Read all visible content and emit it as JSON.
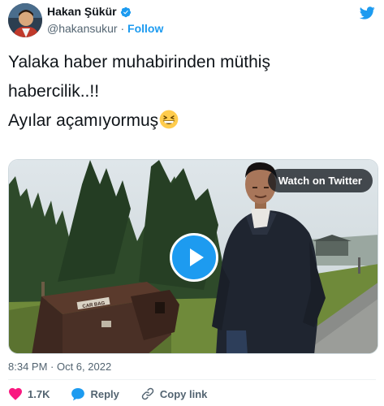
{
  "author": {
    "display_name": "Hakan Şükür",
    "handle": "@hakansukur",
    "separator": "·",
    "follow_label": "Follow"
  },
  "tweet": {
    "lines": [
      "Yalaka haber muhabirinden müthiş",
      "habercilik..!!",
      "Ayılar açamıyormuş"
    ],
    "emoji": "grinning-squinting-face"
  },
  "media": {
    "watch_label": "Watch on Twitter",
    "bin_label": "CAR BAG"
  },
  "timestamp": "8:34 PM · Oct 6, 2022",
  "actions": {
    "likes": "1.7K",
    "reply_label": "Reply",
    "copy_label": "Copy link"
  },
  "colors": {
    "accent": "#1d9bf0",
    "like": "#f91880",
    "text": "#0f1419",
    "muted": "#536471"
  },
  "icons": [
    "twitter-bird-icon",
    "verified-badge-icon",
    "heart-icon",
    "reply-bubble-icon",
    "link-icon",
    "play-icon"
  ]
}
